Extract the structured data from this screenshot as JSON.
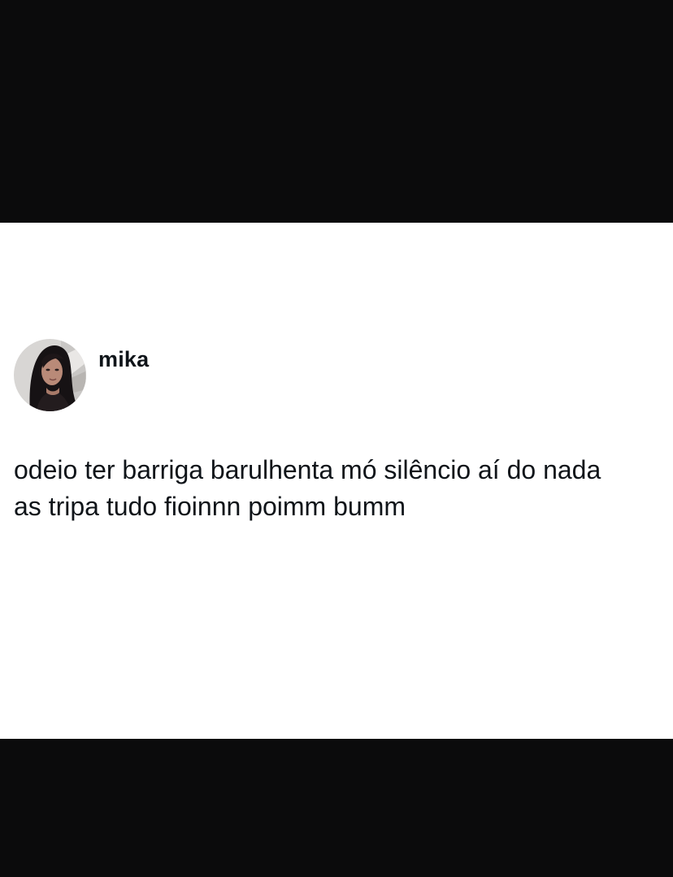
{
  "tweet": {
    "author": {
      "display_name": "mika",
      "avatar_icon": "profile-photo"
    },
    "text_lines": [
      "odeio ter barriga barulhenta mó silêncio aí do nada",
      "as tripa tudo fioinnn poimm bumm"
    ]
  },
  "colors": {
    "letterbox": "#0b0b0c",
    "card_background": "#ffffff",
    "text": "#0f1419"
  }
}
